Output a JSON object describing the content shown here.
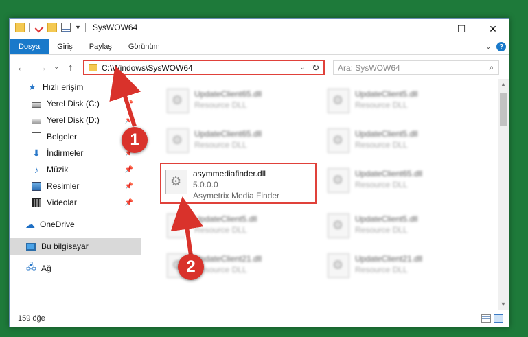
{
  "window": {
    "title": "SysWOW64",
    "controls": {
      "minimize": "—",
      "maximize": "☐",
      "close": "✕"
    }
  },
  "ribbon": {
    "tabs": [
      {
        "label": "Dosya"
      },
      {
        "label": "Giriş"
      },
      {
        "label": "Paylaş"
      },
      {
        "label": "Görünüm"
      }
    ],
    "help": "?"
  },
  "nav": {
    "back": "←",
    "forward": "→",
    "recent": "⌄",
    "up": "↑",
    "address": "C:\\Windows\\SysWOW64",
    "search_placeholder": "Ara: SysWOW64"
  },
  "sidebar": {
    "items": [
      {
        "label": "Hızlı erişim"
      },
      {
        "label": "Yerel Disk (C:)"
      },
      {
        "label": "Yerel Disk (D:)"
      },
      {
        "label": "Belgeler"
      },
      {
        "label": "İndirmeler"
      },
      {
        "label": "Müzik"
      },
      {
        "label": "Resimler"
      },
      {
        "label": "Videolar"
      },
      {
        "label": "OneDrive"
      },
      {
        "label": "Bu bilgisayar"
      },
      {
        "label": "Ağ"
      }
    ]
  },
  "files": [
    {
      "name": "UpdateClient65.dll",
      "desc": "Resource DLL"
    },
    {
      "name": "UpdateClient5.dll",
      "desc": "Resource DLL"
    },
    {
      "name": "UpdateClient65.dll",
      "desc": "Resource DLL"
    },
    {
      "name": "UpdateClient5.dll",
      "desc": "Resource DLL"
    },
    {
      "name": "asymmediafinder.dll",
      "version": "5.0.0.0",
      "desc": "Asymetrix Media Finder"
    },
    {
      "name": "UpdateClient65.dll",
      "desc": "Resource DLL"
    },
    {
      "name": "UpdateClient5.dll",
      "desc": "Resource DLL"
    },
    {
      "name": "UpdateClient5.dll",
      "desc": "Resource DLL"
    },
    {
      "name": "UpdateClient21.dll",
      "desc": "Resource DLL"
    },
    {
      "name": "UpdateClient21.dll",
      "desc": "Resource DLL"
    }
  ],
  "status": {
    "count": "159 öğe"
  },
  "callouts": {
    "one": "1",
    "two": "2"
  },
  "colors": {
    "accent": "#1979ca",
    "highlight": "#e0413a",
    "background": "#1e7a3a"
  }
}
